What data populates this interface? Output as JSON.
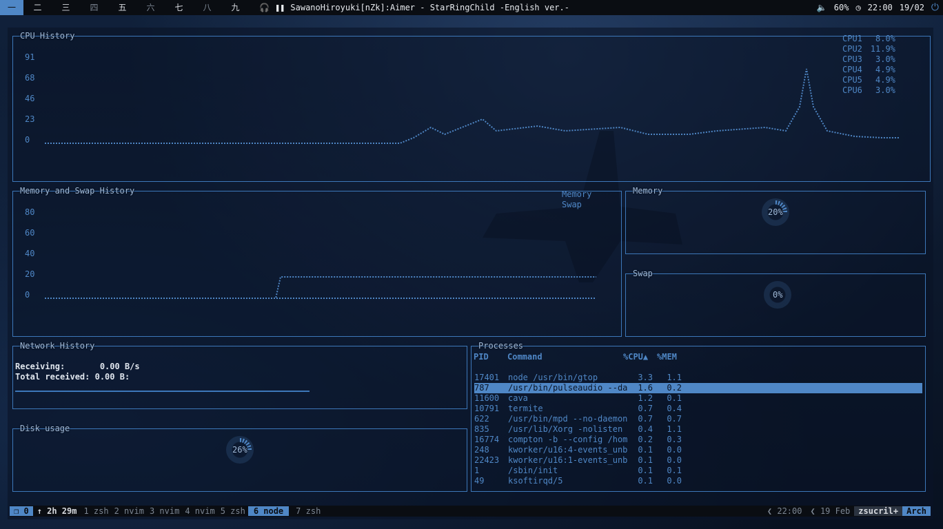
{
  "topbar": {
    "workspaces": [
      "一",
      "二",
      "三",
      "四",
      "五",
      "六",
      "七",
      "八",
      "九"
    ],
    "now_playing": "SawanoHiroyuki[nZk]:Aimer - StarRingChild -English ver.-",
    "volume": "60%",
    "time": "22:00",
    "date": "19/02"
  },
  "cpu": {
    "title": "CPU History",
    "y_ticks": [
      "91",
      "68",
      "46",
      "23",
      "0"
    ],
    "legend": [
      {
        "name": "CPU1",
        "value": "8.0%"
      },
      {
        "name": "CPU2",
        "value": "11.9%"
      },
      {
        "name": "CPU3",
        "value": "3.0%"
      },
      {
        "name": "CPU4",
        "value": "4.9%"
      },
      {
        "name": "CPU5",
        "value": "4.9%"
      },
      {
        "name": "CPU6",
        "value": "3.0%"
      }
    ]
  },
  "mem_history": {
    "title": "Memory and Swap History",
    "y_ticks": [
      "80",
      "60",
      "40",
      "20",
      "0"
    ],
    "legend": [
      "Memory",
      "Swap"
    ]
  },
  "memory": {
    "title": "Memory",
    "value": "20%",
    "fraction": 0.2
  },
  "swap": {
    "title": "Swap",
    "value": "0%",
    "fraction": 0.0
  },
  "network": {
    "title": "Network History",
    "receiving_label": "Receiving:",
    "receiving_value": "0.00 B/s",
    "total_label": "Total received:",
    "total_value": "0.00 B:"
  },
  "disk": {
    "title": "Disk usage",
    "value": "26%",
    "fraction": 0.26
  },
  "processes": {
    "title": "Processes",
    "headers": {
      "pid": "PID",
      "command": "Command",
      "cpu": "%CPU▲",
      "mem": "%MEM"
    },
    "rows": [
      {
        "pid": "17401",
        "cmd": "node /usr/bin/gtop",
        "cpu": "3.3",
        "mem": "1.1"
      },
      {
        "pid": "787",
        "cmd": "/usr/bin/pulseaudio --da",
        "cpu": "1.6",
        "mem": "0.2"
      },
      {
        "pid": "11600",
        "cmd": "cava",
        "cpu": "1.2",
        "mem": "0.1"
      },
      {
        "pid": "10791",
        "cmd": "termite",
        "cpu": "0.7",
        "mem": "0.4"
      },
      {
        "pid": "622",
        "cmd": "/usr/bin/mpd --no-daemon",
        "cpu": "0.7",
        "mem": "0.7"
      },
      {
        "pid": "835",
        "cmd": "/usr/lib/Xorg -nolisten",
        "cpu": "0.4",
        "mem": "1.1"
      },
      {
        "pid": "16774",
        "cmd": "compton -b --config /hom",
        "cpu": "0.2",
        "mem": "0.3"
      },
      {
        "pid": "248",
        "cmd": "kworker/u16:4-events_unb",
        "cpu": "0.1",
        "mem": "0.0"
      },
      {
        "pid": "22423",
        "cmd": "kworker/u16:1-events_unb",
        "cpu": "0.1",
        "mem": "0.0"
      },
      {
        "pid": "1",
        "cmd": "/sbin/init",
        "cpu": "0.1",
        "mem": "0.1"
      },
      {
        "pid": "49",
        "cmd": "ksoftirqd/5",
        "cpu": "0.1",
        "mem": "0.0"
      }
    ]
  },
  "tmux": {
    "session": "0",
    "uptime": "↑ 2h 29m",
    "windows": [
      "1 zsh",
      "2 nvim",
      "3 nvim",
      "4 nvim",
      "5 zsh"
    ],
    "current": "6 node",
    "after": [
      "7 zsh"
    ],
    "time": "22:00",
    "date": "19 Feb",
    "host": "zsucril+",
    "os": "Arch"
  }
}
